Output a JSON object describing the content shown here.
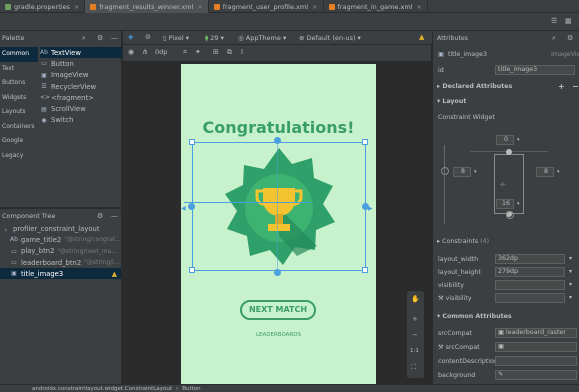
{
  "tabs": [
    {
      "label": "gradle.properties",
      "color": "#6f9f5f",
      "active": false
    },
    {
      "label": "fragment_results_winner.xml",
      "color": "#e67e22",
      "active": true
    },
    {
      "label": "fragment_user_profile.xml",
      "color": "#e67e22",
      "active": false
    },
    {
      "label": "fragment_in_game.xml",
      "color": "#e67e22",
      "active": false
    }
  ],
  "toolbar": {
    "pixel_label": "Pixel",
    "api_label": "29",
    "theme_label": "AppTheme",
    "locale_label": "Default (en-us)",
    "dp_value": "0dp"
  },
  "palette": {
    "title": "Palette",
    "categories": [
      "Common",
      "Text",
      "Buttons",
      "Widgets",
      "Layouts",
      "Containers",
      "Google",
      "Legacy"
    ],
    "selected_category": 0,
    "items": [
      {
        "label": "TextView",
        "icon": "Ab"
      },
      {
        "label": "Button",
        "icon": "▭"
      },
      {
        "label": "ImageView",
        "icon": "▣"
      },
      {
        "label": "RecyclerView",
        "icon": "☰"
      },
      {
        "label": "<fragment>",
        "icon": "<>"
      },
      {
        "label": "ScrollView",
        "icon": "▤"
      },
      {
        "label": "Switch",
        "icon": "◉"
      }
    ]
  },
  "component_tree": {
    "title": "Component Tree",
    "items": [
      {
        "label": "profiler_constraint_layout",
        "sub": "",
        "icon": "⌞",
        "indent": 0,
        "selected": false,
        "warn": false
      },
      {
        "label": "game_title2",
        "sub": "\"@string/congrat...",
        "icon": "Ab",
        "indent": 1,
        "selected": false,
        "warn": false
      },
      {
        "label": "play_btn2",
        "sub": "\"@string/next_ma...",
        "icon": "▭",
        "indent": 1,
        "selected": false,
        "warn": false
      },
      {
        "label": "leaderboard_btn2",
        "sub": "\"@string/l...",
        "icon": "▭",
        "indent": 1,
        "selected": false,
        "warn": false
      },
      {
        "label": "title_image3",
        "sub": "",
        "icon": "▣",
        "indent": 1,
        "selected": true,
        "warn": true
      }
    ]
  },
  "phone": {
    "heading": "Congratulations!",
    "primary_button": "NEXT MATCH",
    "secondary_link": "LEADERBOARDS"
  },
  "attributes": {
    "title": "Attributes",
    "element_name": "title_image3",
    "element_type": "ImageView",
    "id_label": "id",
    "id_value": "title_image3",
    "declared_label": "Declared Attributes",
    "layout_label": "Layout",
    "constraint_widget": "Constraint Widget",
    "margin_top": "0",
    "margin_left": "8",
    "margin_right": "8",
    "margin_bottom": "16",
    "constraints_label": "Constraints",
    "constraints_count": "(4)",
    "layout_width_label": "layout_width",
    "layout_width_value": "362dp",
    "layout_height_label": "layout_height",
    "layout_height_value": "279dp",
    "visibility_label": "visibility",
    "visibility_label2": "visibility",
    "common_label": "Common Attributes",
    "srccompat_label": "srcCompat",
    "srccompat_value": "leaderboard_raster",
    "srccompat2_label": "srcCompat",
    "content_desc_label": "contentDescription",
    "background_label": "background"
  },
  "status": {
    "path": "androidx.constraintlayout.widget.ConstraintLayout",
    "leaf": "Button"
  }
}
